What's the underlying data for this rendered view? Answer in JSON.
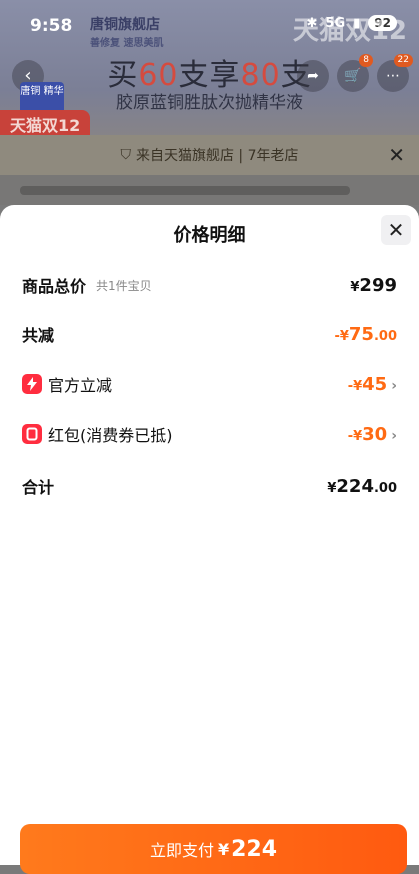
{
  "status": {
    "time": "9:58",
    "battery": "92",
    "network": "5G"
  },
  "background": {
    "store_name": "唐铜旗舰店",
    "store_sub": "善修复 速思美肌",
    "promo_title_pre": "买",
    "promo_title_n1": "60",
    "promo_title_mid": "支享",
    "promo_title_n2": "80",
    "promo_title_post": "支",
    "promo_sub": "胶原蓝铜胜肽次抛精华液",
    "tmall_tag": "天猫双12",
    "tmall_tag_right": "天猫双12",
    "cart_badge": "8",
    "more_badge": "22",
    "brand_logo": "唐铜 精华"
  },
  "source": {
    "text": "来自天猫旗舰店 | 7年老店"
  },
  "sheet": {
    "title": "价格明细",
    "rows": [
      {
        "label": "商品总价",
        "sub": "共1件宝贝",
        "yen": "¥",
        "value": "299",
        "dec": ""
      },
      {
        "label": "共减",
        "yen": "-¥",
        "value": "75",
        "dec": ".00"
      },
      {
        "label": "官方立减",
        "yen": "-¥",
        "value": "45",
        "dec": ""
      },
      {
        "label": "红包(消费券已抵)",
        "yen": "-¥",
        "value": "30",
        "dec": ""
      },
      {
        "label": "合计",
        "yen": "¥",
        "value": "224",
        "dec": ".00"
      }
    ],
    "pay_label": "立即支付",
    "pay_yen": "¥",
    "pay_amount": "224"
  },
  "colors": {
    "accent": "#ff6a13",
    "icon_red": "#ff2d3f"
  }
}
